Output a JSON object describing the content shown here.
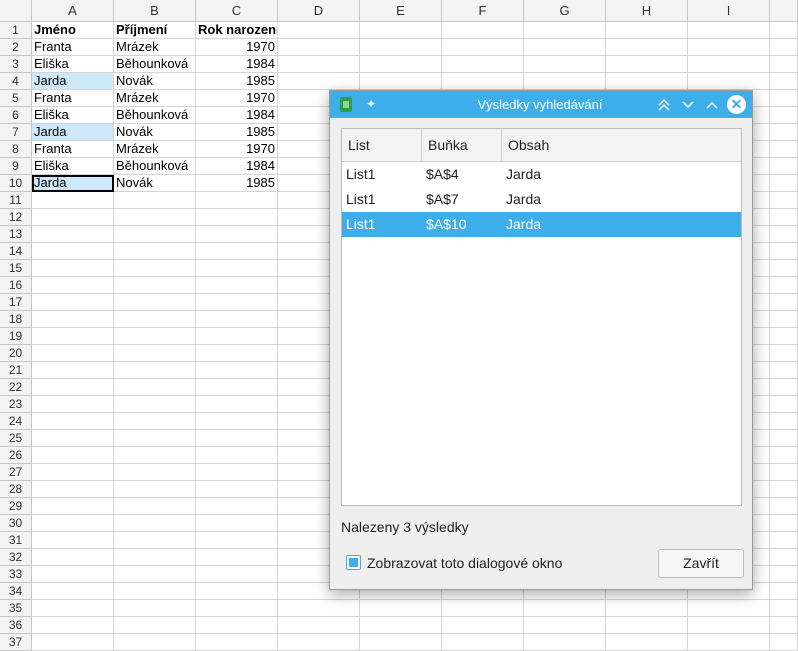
{
  "spreadsheet": {
    "columns": [
      "A",
      "B",
      "C",
      "D",
      "E",
      "F",
      "G",
      "H",
      "I"
    ],
    "rows": [
      [
        "Jméno",
        "Příjmení",
        "Rok narození"
      ],
      [
        "Franta",
        "Mrázek",
        "1970"
      ],
      [
        "Eliška",
        "Běhounková",
        "1984"
      ],
      [
        "Jarda",
        "Novák",
        "1985"
      ],
      [
        "Franta",
        "Mrázek",
        "1970"
      ],
      [
        "Eliška",
        "Běhounková",
        "1984"
      ],
      [
        "Jarda",
        "Novák",
        "1985"
      ],
      [
        "Franta",
        "Mrázek",
        "1970"
      ],
      [
        "Eliška",
        "Běhounková",
        "1984"
      ],
      [
        "Jarda",
        "Novák",
        "1985"
      ]
    ],
    "row_numbers": [
      "1",
      "2",
      "3",
      "4",
      "5",
      "6",
      "7",
      "8",
      "9",
      "10",
      "11",
      "12",
      "13",
      "14",
      "15",
      "16",
      "17",
      "18",
      "19",
      "20",
      "21",
      "22",
      "23",
      "24",
      "25",
      "26",
      "27",
      "28",
      "29",
      "30",
      "31",
      "32",
      "33",
      "34",
      "35",
      "36",
      "37"
    ],
    "highlighted_cells": [
      "A4",
      "A7",
      "A10"
    ],
    "active_cell": "A10"
  },
  "dialog": {
    "title": "Výsledky vyhledávání",
    "columns": [
      "List",
      "Buňka",
      "Obsah"
    ],
    "results": [
      {
        "sheet": "List1",
        "cell": "$A$4",
        "content": "Jarda",
        "selected": false
      },
      {
        "sheet": "List1",
        "cell": "$A$7",
        "content": "Jarda",
        "selected": false
      },
      {
        "sheet": "List1",
        "cell": "$A$10",
        "content": "Jarda",
        "selected": true
      }
    ],
    "status": "Nalezeny 3 výsledky",
    "show_dialog_label": "Zobrazovat toto dialogové okno",
    "show_dialog_checked": true,
    "close_label": "Zavřít",
    "titlebar_icons": {
      "pin": "pin-icon",
      "keep_above": "double-chevron-up-icon",
      "minimize": "chevron-down-icon",
      "maximize": "chevron-up-icon",
      "close": "close-icon"
    },
    "accent_color": "#3daee9"
  }
}
